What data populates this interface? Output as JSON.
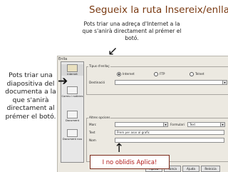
{
  "slide": {
    "title": "Segueix la ruta Insereix/enllaç",
    "subtitle": "Pots triar una adreça d'Internet a la que s'anirà directament al prémer el botó.",
    "left_note": "Pots triar una diapositiva del documenta a la que s'anirà directament al prémer el botó.",
    "callout": "I no oblidis Aplica!"
  },
  "dialog": {
    "title": "Enlla",
    "sidebar": [
      {
        "label": "Internet",
        "icon": "globe-icon"
      },
      {
        "label": "Correu i notícies",
        "icon": "mail-icon"
      },
      {
        "label": "Document",
        "icon": "document-icon"
      },
      {
        "label": "Document nou",
        "icon": "new-document-icon"
      }
    ],
    "hyperlink_group": "Tipus d'enllaç",
    "radios": [
      "Internet",
      "FTP",
      "Telnet"
    ],
    "target_label": "Destinació",
    "further_group": "Altres opcions",
    "frame_label": "Marc",
    "form_label": "Formulari",
    "form_value": "Text",
    "text_label": "Text",
    "text_value": "Prem per anar al grafic",
    "name_label": "Nom",
    "buttons": {
      "apply": "Aplica",
      "close": "Tanca",
      "help": "Ajuda",
      "back": "Reinicia"
    }
  }
}
